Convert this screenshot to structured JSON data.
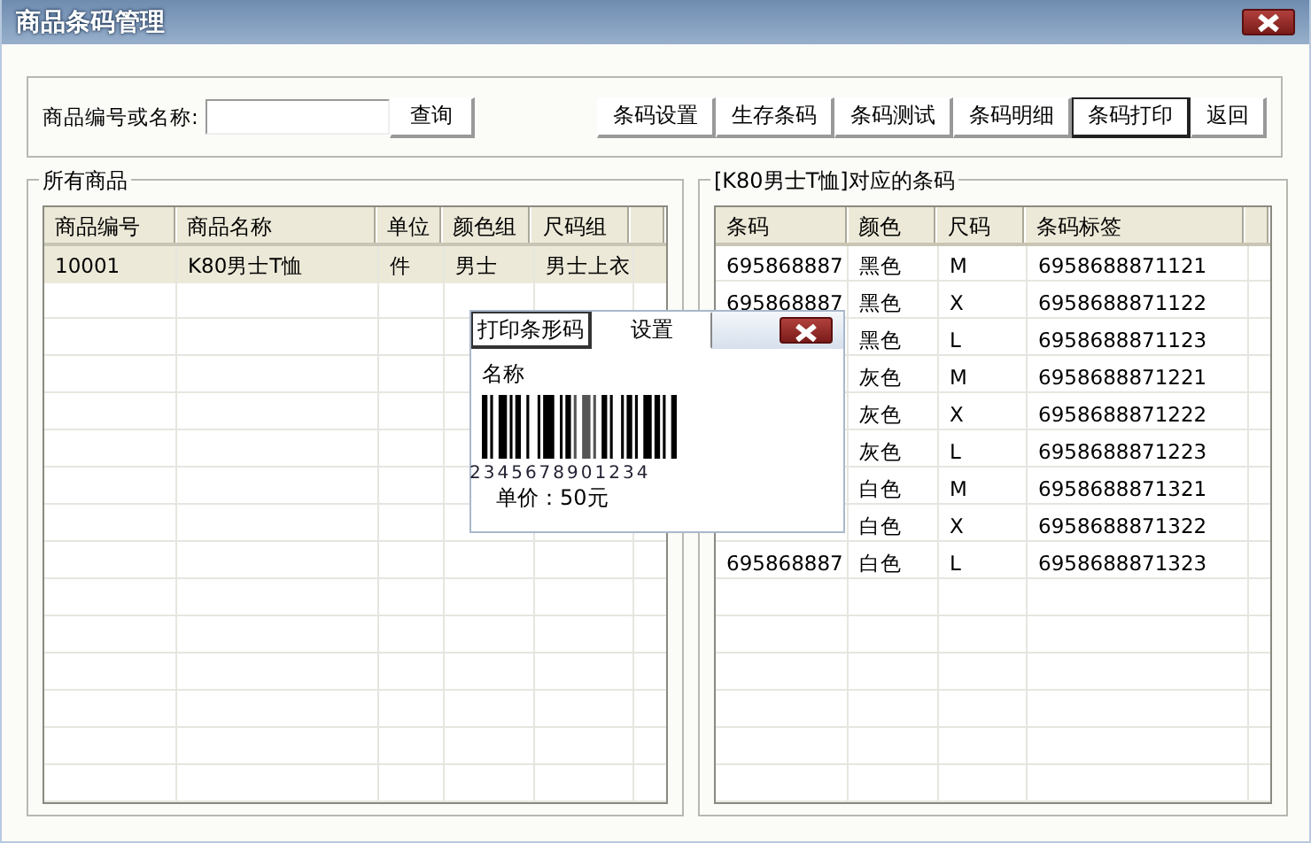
{
  "window": {
    "title": "商品条码管理"
  },
  "search": {
    "label": "商品编号或名称:",
    "button": "查询"
  },
  "toolbar": [
    {
      "label": "条码设置",
      "selected": false
    },
    {
      "label": "生存条码",
      "selected": false
    },
    {
      "label": "条码测试",
      "selected": false
    },
    {
      "label": "条码明细",
      "selected": false
    },
    {
      "label": "条码打印",
      "selected": true
    },
    {
      "label": "返回",
      "selected": false
    }
  ],
  "products": {
    "title": "所有商品",
    "columns": [
      "商品编号",
      "商品名称",
      "单位",
      "颜色组",
      "尺码组"
    ],
    "rows": [
      {
        "cells": [
          "10001",
          "K80男士T恤",
          "件",
          "男士",
          "男士上衣"
        ],
        "selected": true
      }
    ]
  },
  "barcodes": {
    "title": "[K80男士T恤]对应的条码",
    "columns": [
      "条码",
      "颜色",
      "尺码",
      "条码标签"
    ],
    "rows": [
      {
        "cells": [
          "695868887",
          "黑色",
          "M",
          "6958688871121"
        ]
      },
      {
        "cells": [
          "695868887",
          "黑色",
          "X",
          "6958688871122"
        ]
      },
      {
        "cells": [
          null,
          "黑色",
          "L",
          "6958688871123"
        ]
      },
      {
        "cells": [
          null,
          "灰色",
          "M",
          "6958688871221"
        ]
      },
      {
        "cells": [
          null,
          "灰色",
          "X",
          "6958688871222"
        ]
      },
      {
        "cells": [
          null,
          "灰色",
          "L",
          "6958688871223"
        ]
      },
      {
        "cells": [
          null,
          "白色",
          "M",
          "6958688871321"
        ]
      },
      {
        "cells": [
          null,
          "白色",
          "X",
          "6958688871322"
        ]
      },
      {
        "cells": [
          "695868887",
          "白色",
          "L",
          "6958688871323"
        ]
      }
    ]
  },
  "popup": {
    "tabs": [
      {
        "label": "打印条形码",
        "selected": true
      },
      {
        "label": "设置",
        "selected": false
      }
    ],
    "name_label": "名称",
    "digits": "2345678901234",
    "price": "单价：50元"
  }
}
